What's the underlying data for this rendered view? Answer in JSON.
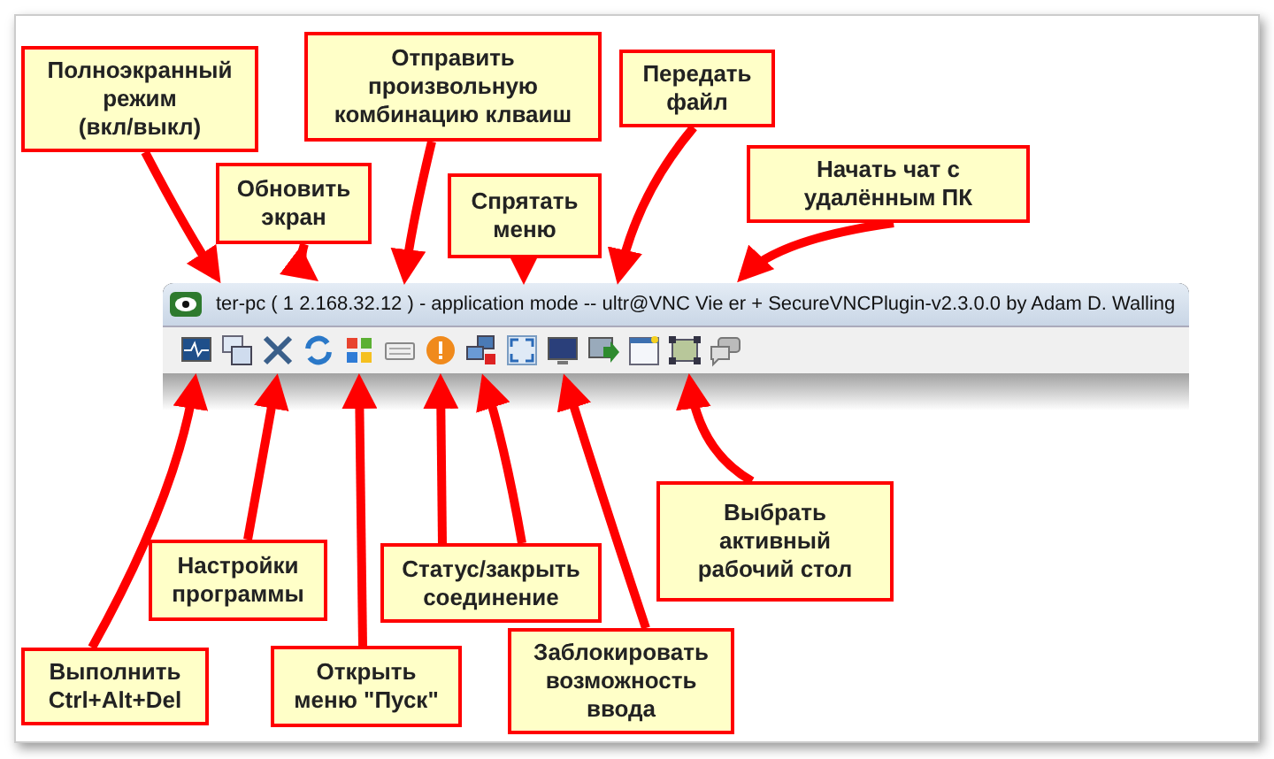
{
  "window": {
    "title": "ter-pc ( 1 2.168.32.12 ) - application mode -- ultr@VNC Vie er + SecureVNCPlugin-v2.3.0.0 by Adam D. Walling"
  },
  "callouts": [
    {
      "lines": [
        "Полноэкранный",
        "режим",
        "(вкл/выкл)"
      ]
    },
    {
      "lines": [
        "Обновить",
        "экран"
      ]
    },
    {
      "lines": [
        "Отправить",
        "произвольную",
        "комбинацию клваиш"
      ]
    },
    {
      "lines": [
        "Спрятать",
        "меню"
      ]
    },
    {
      "lines": [
        "Передать",
        "файл"
      ]
    },
    {
      "lines": [
        "Начать чат с",
        "удалённым ПК"
      ]
    },
    {
      "lines": [
        "Выполнить",
        "Ctrl+Alt+Del"
      ]
    },
    {
      "lines": [
        "Настройки",
        "программы"
      ]
    },
    {
      "lines": [
        "Открыть",
        "меню \"Пуск\""
      ]
    },
    {
      "lines": [
        "Статус/закрыть",
        "соединение"
      ]
    },
    {
      "lines": [
        "Заблокировать",
        "возможность",
        "ввода"
      ]
    },
    {
      "lines": [
        "Выбрать",
        "активный",
        "рабочий стол"
      ]
    }
  ]
}
